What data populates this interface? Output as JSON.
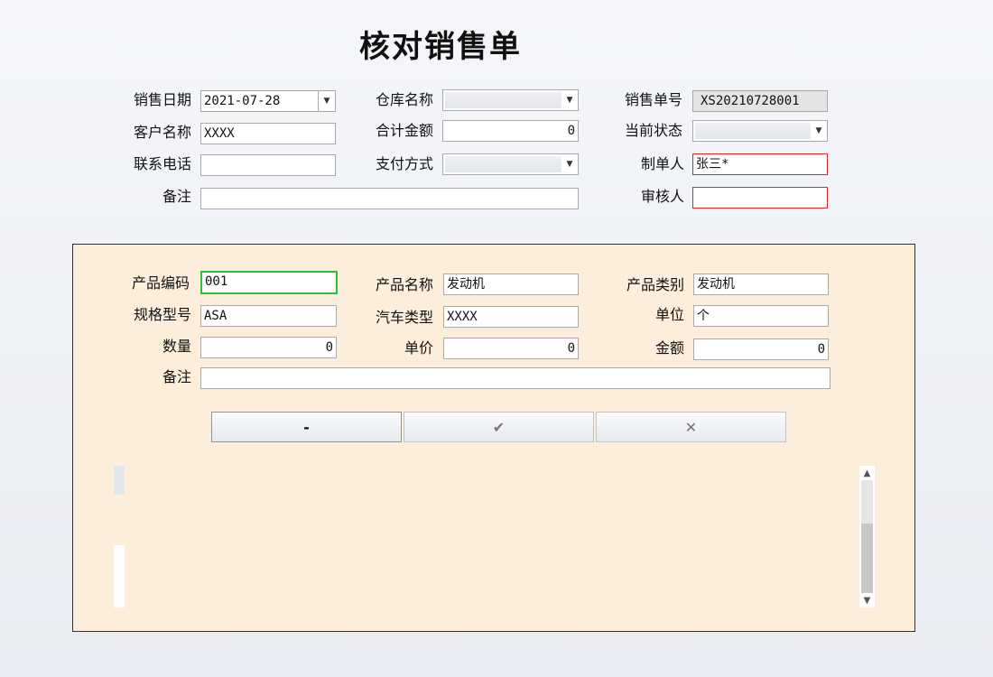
{
  "window": {
    "title": "核对销售单"
  },
  "header": {
    "sale_date": {
      "label": "销售日期",
      "value": "2021-07-28"
    },
    "warehouse": {
      "label": "仓库名称",
      "value": ""
    },
    "order_no": {
      "label": "销售单号",
      "value": "XS20210728001"
    },
    "customer": {
      "label": "客户名称",
      "value": "XXXX"
    },
    "total": {
      "label": "合计金额",
      "value": "0"
    },
    "status": {
      "label": "当前状态",
      "value": ""
    },
    "phone": {
      "label": "联系电话",
      "value": ""
    },
    "payment": {
      "label": "支付方式",
      "value": ""
    },
    "creator": {
      "label": "制单人",
      "value": "张三*"
    },
    "remark": {
      "label": "备注",
      "value": ""
    },
    "reviewer": {
      "label": "审核人",
      "value": ""
    }
  },
  "detail": {
    "product_code": {
      "label": "产品编码",
      "value": "001"
    },
    "product_name": {
      "label": "产品名称",
      "value": "发动机"
    },
    "product_category": {
      "label": "产品类别",
      "value": "发动机"
    },
    "spec": {
      "label": "规格型号",
      "value": "ASA"
    },
    "car_type": {
      "label": "汽车类型",
      "value": "XXXX"
    },
    "unit": {
      "label": "单位",
      "value": "个"
    },
    "quantity": {
      "label": "数量",
      "value": "0"
    },
    "unit_price": {
      "label": "单价",
      "value": "0"
    },
    "amount": {
      "label": "金额",
      "value": "0"
    },
    "remark": {
      "label": "备注",
      "value": ""
    }
  },
  "buttons": {
    "remove": "-",
    "confirm": "✔",
    "cancel": "✕"
  },
  "icons": {
    "dropdown": "chevron-down-icon",
    "scroll_up": "chevron-up-icon",
    "scroll_down": "chevron-down-icon"
  },
  "colors": {
    "panel_bg": "#fdeedb",
    "required_border": "#d12a2a",
    "focus_border": "#2bbf3c"
  }
}
